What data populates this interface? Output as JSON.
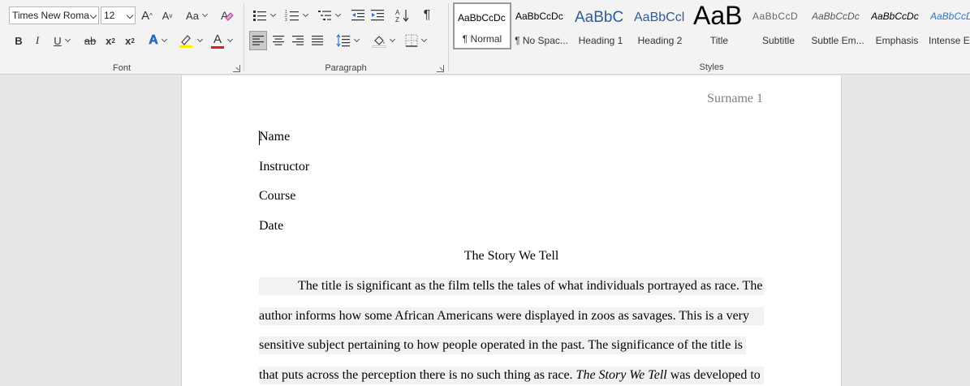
{
  "font_group": {
    "label": "Font",
    "font_name": "Times New Roma",
    "font_size": "12",
    "grow_label": "A",
    "shrink_label": "A",
    "case_label": "Aa",
    "bold": "B",
    "italic": "I",
    "underline": "U",
    "strike": "ab",
    "subscript": "x",
    "superscript": "x",
    "effects": "A",
    "font_color_label": "A",
    "highlight_color": "#ffeb00",
    "font_color": "#e01c1c"
  },
  "paragraph_group": {
    "label": "Paragraph",
    "pilcrow": "¶"
  },
  "styles_group": {
    "label": "Styles",
    "items": [
      {
        "sample": "AaBbCcDc",
        "name": "¶ Normal"
      },
      {
        "sample": "AaBbCcDc",
        "name": "¶ No Spac..."
      },
      {
        "sample": "AaBbC",
        "name": "Heading 1"
      },
      {
        "sample": "AaBbCcl",
        "name": "Heading 2"
      },
      {
        "sample": "AaB",
        "name": "Title"
      },
      {
        "sample": "AaBbCcD",
        "name": "Subtitle"
      },
      {
        "sample": "AaBbCcDc",
        "name": "Subtle Em..."
      },
      {
        "sample": "AaBbCcDc",
        "name": "Emphasis"
      },
      {
        "sample": "AaBbCcDc",
        "name": "Intense E..."
      }
    ]
  },
  "document": {
    "header": "Surname 1",
    "lines": [
      "Name",
      "Instructor",
      "Course",
      "Date"
    ],
    "title": "The Story We Tell",
    "body": [
      "The title is significant as the film tells the tales of what individuals portrayed as race. The",
      "author informs how some African Americans were displayed in zoos as savages. This is a very",
      "sensitive subject pertaining to how people operated in the past. The significance of the title is"
    ],
    "last_line_before": "that puts across the perception there is no such thing as race. ",
    "last_line_italic": "The Story We Tell",
    "last_line_after": " was developed to"
  }
}
